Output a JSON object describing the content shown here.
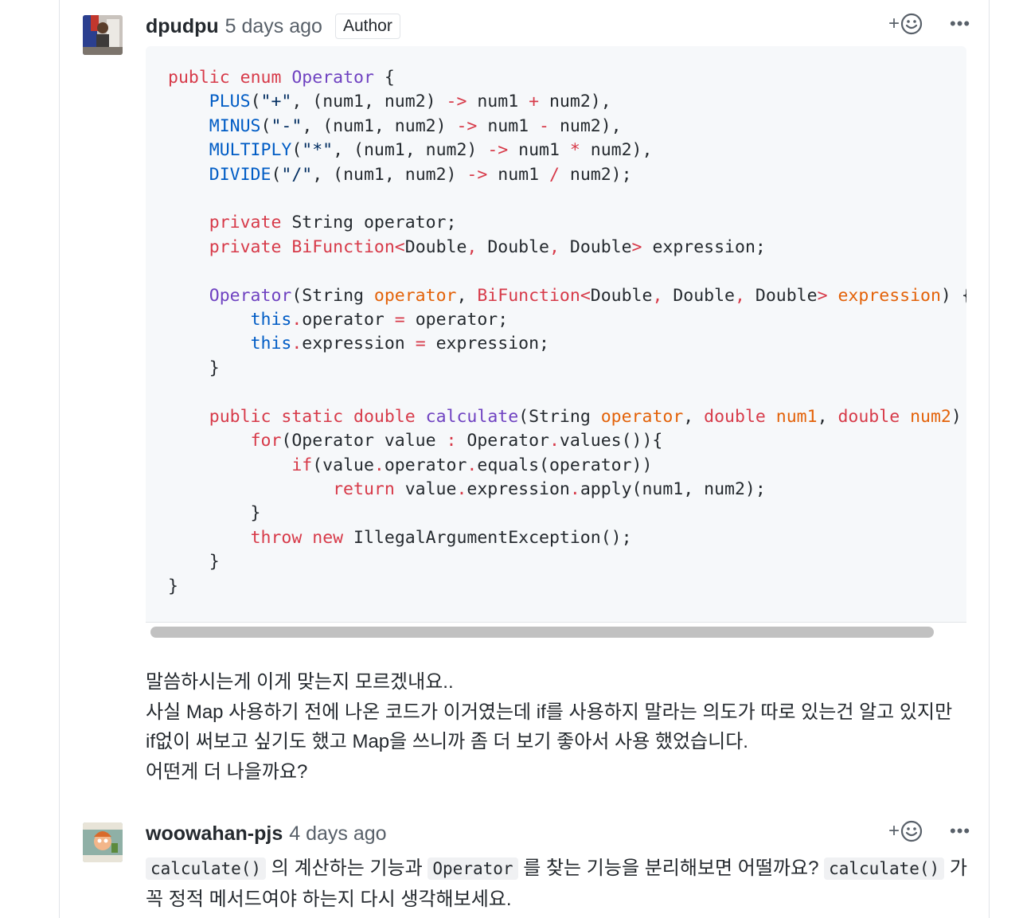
{
  "comments": [
    {
      "author": "dpudpu",
      "timestamp": "5 days ago",
      "badge": "Author",
      "avatar_icon": "user-avatar-photo",
      "code_language": "java",
      "code_lines": [
        [
          [
            "kw",
            "public"
          ],
          [
            "",
            " "
          ],
          [
            "kw",
            "enum"
          ],
          [
            "",
            " "
          ],
          [
            "nm",
            "Operator"
          ],
          [
            "",
            " {"
          ]
        ],
        [
          [
            "",
            "    "
          ],
          [
            "cn",
            "PLUS"
          ],
          [
            "",
            "("
          ],
          [
            "st",
            "\"+\""
          ],
          [
            "",
            ", (num1, num2) "
          ],
          [
            "op",
            "->"
          ],
          [
            "",
            ""
          ],
          [
            "",
            ""
          ],
          [
            "",
            ""
          ],
          [
            "",
            ""
          ],
          [
            "",
            ""
          ],
          [
            "",
            ""
          ],
          [
            "",
            ""
          ],
          [
            "",
            ""
          ],
          [
            "",
            ""
          ],
          [
            "",
            " num1 "
          ],
          [
            "op",
            "+"
          ],
          [
            "",
            " num2),"
          ]
        ],
        [
          [
            "",
            "    "
          ],
          [
            "cn",
            "MINUS"
          ],
          [
            "",
            "("
          ],
          [
            "st",
            "\"-\""
          ],
          [
            "",
            ", (num1, num2) "
          ],
          [
            "op",
            "->"
          ],
          [
            "",
            " num1 "
          ],
          [
            "op",
            "-"
          ],
          [
            "",
            " num2),"
          ]
        ],
        [
          [
            "",
            "    "
          ],
          [
            "cn",
            "MULTIPLY"
          ],
          [
            "",
            "("
          ],
          [
            "st",
            "\"*\""
          ],
          [
            "",
            ", (num1, num2) "
          ],
          [
            "op",
            "->"
          ],
          [
            "",
            " num1 "
          ],
          [
            "op",
            "*"
          ],
          [
            "",
            " num2),"
          ]
        ],
        [
          [
            "",
            "    "
          ],
          [
            "cn",
            "DIVIDE"
          ],
          [
            "",
            "("
          ],
          [
            "st",
            "\"/\""
          ],
          [
            "",
            ", (num1, num2) "
          ],
          [
            "op",
            "->"
          ],
          [
            "",
            " num1 "
          ],
          [
            "op",
            "/"
          ],
          [
            "",
            " num2);"
          ]
        ],
        [
          [
            "",
            ""
          ]
        ],
        [
          [
            "",
            "    "
          ],
          [
            "kw",
            "private"
          ],
          [
            "",
            " String operator;"
          ]
        ],
        [
          [
            "",
            "    "
          ],
          [
            "kw",
            "private"
          ],
          [
            "",
            " "
          ],
          [
            "kw",
            "BiFunction"
          ],
          [
            "op",
            "<"
          ],
          [
            "",
            "Double"
          ],
          [
            "op",
            ","
          ],
          [
            "",
            " Double"
          ],
          [
            "op",
            ","
          ],
          [
            "",
            " Double"
          ],
          [
            "op",
            ">"
          ],
          [
            "",
            " expression;"
          ]
        ],
        [
          [
            "",
            ""
          ]
        ],
        [
          [
            "",
            "    "
          ],
          [
            "nm",
            "Operator"
          ],
          [
            "",
            "(String "
          ],
          [
            "pr",
            "operator"
          ],
          [
            "",
            ", "
          ],
          [
            "kw",
            "BiFunction"
          ],
          [
            "op",
            "<"
          ],
          [
            "",
            "Double"
          ],
          [
            "op",
            ","
          ],
          [
            "",
            " Double"
          ],
          [
            "op",
            ","
          ],
          [
            "",
            " Double"
          ],
          [
            "op",
            ">"
          ],
          [
            "",
            " "
          ],
          [
            "pr",
            "expression"
          ],
          [
            "",
            ") {"
          ]
        ],
        [
          [
            "",
            "        "
          ],
          [
            "cn",
            "this"
          ],
          [
            "op",
            "."
          ],
          [
            "",
            "operator "
          ],
          [
            "op",
            "="
          ],
          [
            "",
            " operator;"
          ]
        ],
        [
          [
            "",
            "        "
          ],
          [
            "cn",
            "this"
          ],
          [
            "op",
            "."
          ],
          [
            "",
            "expression "
          ],
          [
            "op",
            "="
          ],
          [
            "",
            " expression;"
          ]
        ],
        [
          [
            "",
            "    }"
          ]
        ],
        [
          [
            "",
            ""
          ]
        ],
        [
          [
            "",
            "    "
          ],
          [
            "kw",
            "public"
          ],
          [
            "",
            " "
          ],
          [
            "kw",
            "static"
          ],
          [
            "",
            " "
          ],
          [
            "kw",
            "double"
          ],
          [
            "",
            " "
          ],
          [
            "nm",
            "calculate"
          ],
          [
            "",
            "(String "
          ],
          [
            "pr",
            "operator"
          ],
          [
            "",
            ", "
          ],
          [
            "kw",
            "double"
          ],
          [
            "",
            " "
          ],
          [
            "pr",
            "num1"
          ],
          [
            "",
            ", "
          ],
          [
            "kw",
            "double"
          ],
          [
            "",
            " "
          ],
          [
            "pr",
            "num2"
          ],
          [
            "",
            ") {"
          ]
        ],
        [
          [
            "",
            "        "
          ],
          [
            "kw",
            "for"
          ],
          [
            "",
            "(Operator value "
          ],
          [
            "op",
            ":"
          ],
          [
            "",
            " Operator"
          ],
          [
            "op",
            "."
          ],
          [
            "",
            "values()){"
          ]
        ],
        [
          [
            "",
            "            "
          ],
          [
            "kw",
            "if"
          ],
          [
            "",
            "(value"
          ],
          [
            "op",
            "."
          ],
          [
            "",
            "operator"
          ],
          [
            "op",
            "."
          ],
          [
            "",
            "equals(operator))"
          ]
        ],
        [
          [
            "",
            "                "
          ],
          [
            "kw",
            "return"
          ],
          [
            "",
            " value"
          ],
          [
            "op",
            "."
          ],
          [
            "",
            "expression"
          ],
          [
            "op",
            "."
          ],
          [
            "",
            "apply(num1, num2);"
          ]
        ],
        [
          [
            "",
            "        }"
          ]
        ],
        [
          [
            "",
            "        "
          ],
          [
            "kw",
            "throw"
          ],
          [
            "",
            " "
          ],
          [
            "kw",
            "new"
          ],
          [
            "",
            " IllegalArgumentException();"
          ]
        ],
        [
          [
            "",
            "    }"
          ]
        ],
        [
          [
            "",
            "}"
          ]
        ]
      ],
      "body_lines": [
        "말씀하시는게 이게 맞는지 모르겠내요..",
        "사실 Map 사용하기 전에 나온 코드가 이거였는데 if를 사용하지 말라는 의도가 따로 있는건 알고 있지만",
        "if없이 써보고 싶기도 했고 Map을 쓰니까 좀 더 보기 좋아서 사용 했었습니다.",
        "어떤게 더 나을까요?"
      ]
    },
    {
      "author": "woowahan-pjs",
      "timestamp": "4 days ago",
      "avatar_icon": "cartoon-avatar",
      "body_parts": [
        {
          "code": "calculate()"
        },
        {
          "text": " 의 계산하는 기능과 "
        },
        {
          "code": "Operator"
        },
        {
          "text": " 를 찾는 기능을 분리해보면 어떨까요? "
        },
        {
          "code": "calculate()"
        },
        {
          "text": " 가 꼭 정적 메서드여야 하는지 다시 생각해보세요."
        }
      ]
    }
  ],
  "actions": {
    "add_reaction_icon": "smiley-plus-icon",
    "more_icon": "kebab-horizontal-icon",
    "more_label": "•••",
    "plus_label": "+"
  }
}
